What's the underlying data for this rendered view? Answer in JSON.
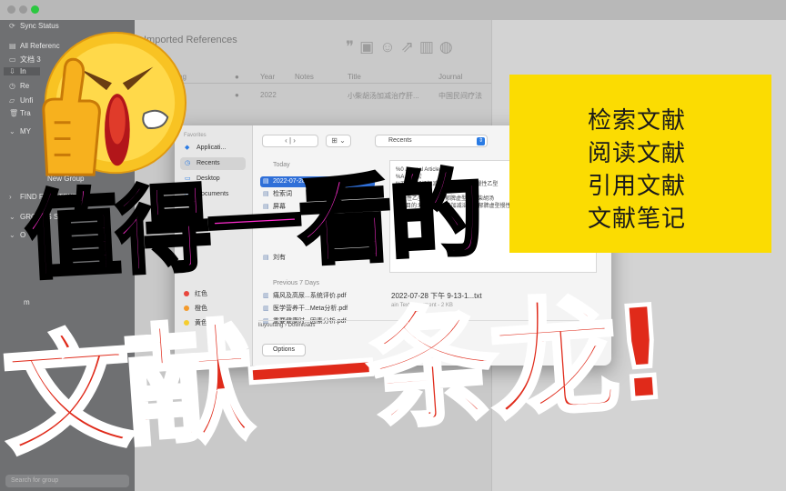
{
  "sidebar": {
    "sync_status": "Sync Status",
    "all_refs": "All Referenc",
    "library": "文档 3",
    "imported": "In",
    "recently": "Re",
    "unfiled": "Unfi",
    "trash": "Tra",
    "my_groups": "MY",
    "new_group": "New Group",
    "find_full_text": "FIND FULL TEXT",
    "groups_shared": "GROUPS SHARED BY O...",
    "online": "O",
    "misc": "m",
    "search_placeholder": "Search for group"
  },
  "main": {
    "title": "Imported References",
    "subtitle": "ences",
    "columns": [
      "ting",
      "●",
      "Year",
      "Notes",
      "Title",
      "Journal"
    ],
    "row": {
      "dot": "●",
      "year": "2022",
      "title": "小柴胡汤加减治疗肝...",
      "journal": "中国民间疗法"
    },
    "toolbar_icons": [
      "quote-icon",
      "clipboard-add-icon",
      "add-user-icon",
      "share-icon",
      "pdf-icon",
      "globe-icon"
    ]
  },
  "dialog": {
    "favorites": "Favorites",
    "fav_items": [
      "Applicati...",
      "Recents",
      "Desktop",
      "Documents"
    ],
    "icloud": "ud",
    "locations": "ions",
    "tags_label": "",
    "tags": [
      {
        "label": "红色",
        "color": "#e8463c"
      },
      {
        "label": "橙色",
        "color": "#f39a2b"
      },
      {
        "label": "黄色",
        "color": "#f5cd2e"
      }
    ],
    "nav": "‹ | ›",
    "view": "⊞ ⌄",
    "location": "Recents",
    "today": "Today",
    "today_files": [
      "2022-07-28 ...Fdgdata.txt",
      "检索词",
      "屏幕",
      "Pub",
      "刘有"
    ],
    "previous7": "Previous 7 Days",
    "prev_files": [
      "痛风及高尿...系统评价.pdf",
      "医学营养干...Meta分析.pdf",
      "重要健康时...因素分析.pdf"
    ],
    "preview_lines": [
      "%0 Journal Article",
      "%A 胡友宏",
      "%T 小柴胡汤加减治疗肝郁脾虚型慢性乙型",
      "",
      "                                  thy",
      "",
      "",
      "             型慢性乙型肝炎；肝郁脾虚型；小柴胡汤",
      "%X 目的:观察小柴胡汤加减治疗肝郁脾虚型慢性乙型肝炎的临床疗效。"
    ],
    "preview_name": "2022-07-28 下午 9-13-1...txt",
    "preview_meta": "ain Text Document - 2 KB",
    "path": "liuyoufang  ›  Downloads",
    "options": "Options"
  },
  "note": {
    "lines": [
      "检索文献",
      "阅读文献",
      "引用文献",
      "文献笔记"
    ],
    "color": "#fbdc02"
  },
  "overlay": {
    "line1": "值得一看的",
    "line2": "文献一条龙!",
    "line1_color": "#ff2ccf",
    "line2_color": "#e02a1a"
  },
  "emoji": {
    "name": "angry-thumbs-up-emoji"
  }
}
